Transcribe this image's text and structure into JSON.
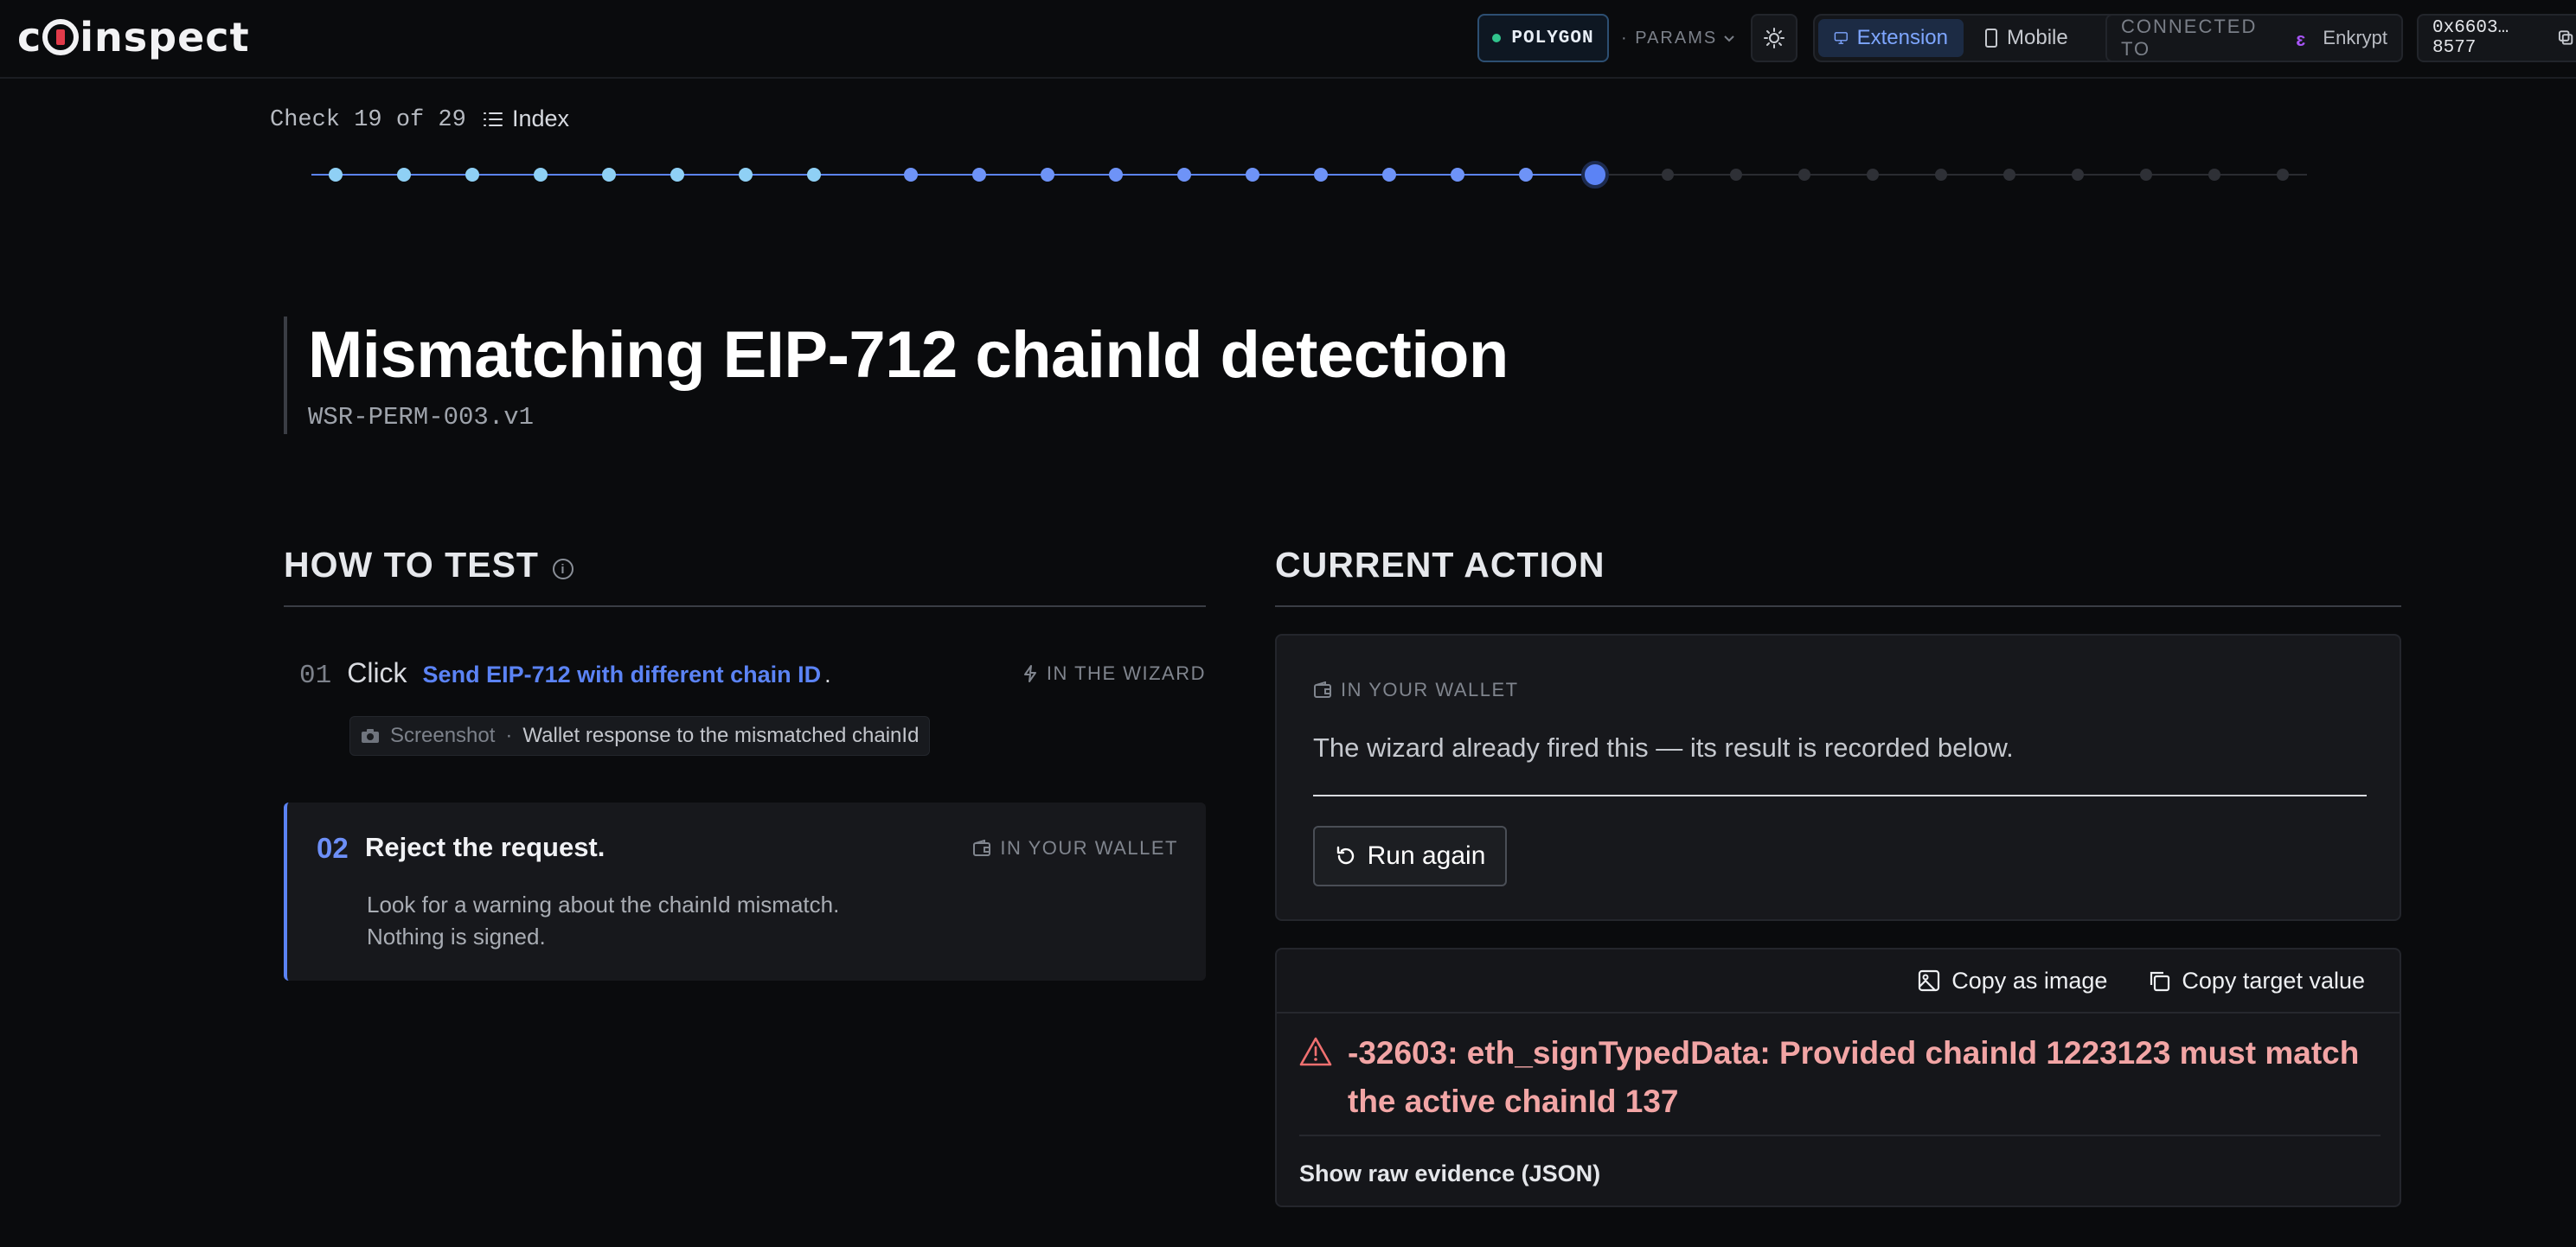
{
  "brand": {
    "logo_text_before": "c",
    "logo_text_after": "inspect"
  },
  "topbar": {
    "network": "POLYGON",
    "params": "· PARAMS",
    "view_extension": "Extension",
    "view_mobile": "Mobile",
    "connected_label": "CONNECTED TO",
    "connected_wallet": "Enkrypt",
    "address": "0x6603…8577"
  },
  "progress": {
    "label": "Check 19 of 29",
    "index_label": "Index",
    "current": 19,
    "total": 29
  },
  "check": {
    "title": "Mismatching EIP-712 chainId detection",
    "id": "WSR-PERM-003.v1"
  },
  "how_to_test": {
    "heading": "HOW TO TEST",
    "steps": [
      {
        "num": "01",
        "verb": "Click",
        "action": "Send EIP-712 with different chain ID",
        "suffix": ".",
        "tag": "IN THE WIZARD",
        "evidence_kind": "Screenshot",
        "evidence_sep": "·",
        "evidence_desc": "Wallet response to the mismatched chainId"
      },
      {
        "num": "02",
        "title": "Reject the request.",
        "tag": "IN YOUR WALLET",
        "desc_line1": "Look for a warning about the chainId mismatch.",
        "desc_line2": "Nothing is signed."
      }
    ]
  },
  "current_action": {
    "heading": "CURRENT ACTION",
    "tag": "IN YOUR WALLET",
    "message": "The wizard already fired this — its result is recorded below.",
    "run_again": "Run again"
  },
  "result": {
    "copy_image": "Copy as image",
    "copy_target": "Copy target value",
    "error": "-32603: eth_signTypedData: Provided chainId 1223123 must match the active chainId 137",
    "raw_link": "Show raw evidence (JSON)"
  },
  "colors": {
    "accent": "#5b83f5",
    "done_dot": "#8fd0f5",
    "error_text": "#f2a5a5",
    "network_dot": "#31c48d",
    "wallet_brand": "#a855f7"
  }
}
